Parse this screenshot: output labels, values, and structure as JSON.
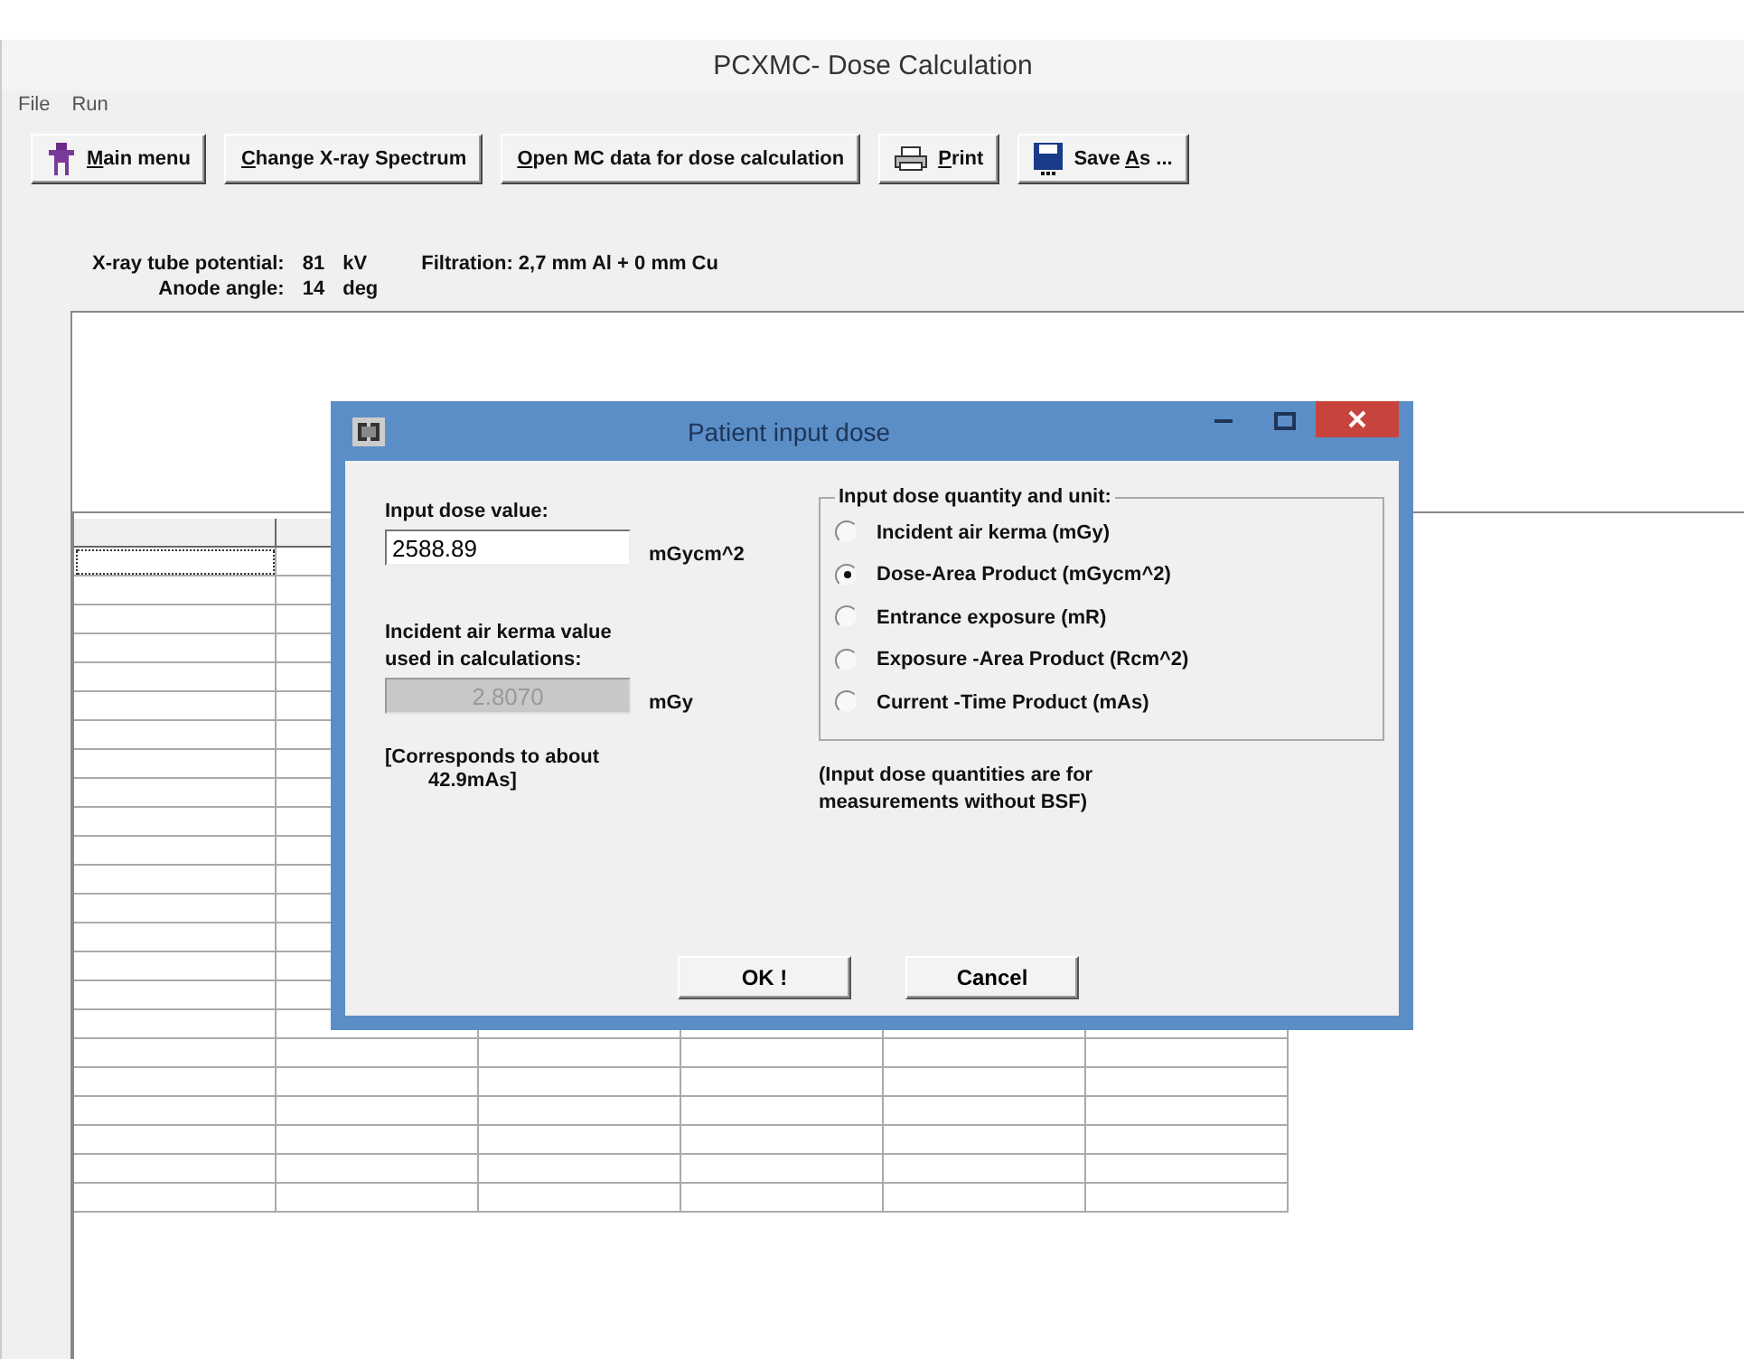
{
  "window": {
    "title": "PCXMC- Dose Calculation"
  },
  "menu": [
    "File",
    "Run"
  ],
  "toolbar": [
    {
      "kind": "person",
      "mnemonic": "M",
      "label_after": "ain menu"
    },
    {
      "kind": "none",
      "mnemonic": "C",
      "label_after": "hange X-ray Spectrum"
    },
    {
      "kind": "none",
      "mnemonic": "O",
      "label_after": "pen MC data for dose calculation"
    },
    {
      "kind": "printer",
      "mnemonic": "P",
      "label_after": "rint"
    },
    {
      "kind": "disk",
      "label_before": "Save ",
      "mnemonic": "A",
      "label_after": "s ..."
    }
  ],
  "info": {
    "tube_potential_label": "X-ray tube potential:",
    "tube_potential": "81",
    "tube_potential_unit": "kV",
    "filtration": "Filtration: 2,7 mm Al + 0 mm Cu",
    "anode_angle_label": "Anode angle:",
    "anode_angle": "14",
    "anode_angle_unit": "deg"
  },
  "dialog": {
    "title": "Patient input dose",
    "input_label": "Input dose value:",
    "input_value": "2588.89",
    "input_unit": "mGycm^2",
    "kerma_label": "Incident air kerma value used in calculations:",
    "kerma_value": "2.8070",
    "kerma_unit": "mGy",
    "note_left": "[Corresponds to about",
    "note_left_2": "42.9mAs]",
    "group_title": "Input dose quantity and unit:",
    "options": [
      {
        "label": "Incident air kerma (mGy)",
        "selected": false
      },
      {
        "label": "Dose-Area Product (mGycm^2)",
        "selected": true
      },
      {
        "label": "Entrance exposure (mR)",
        "selected": false
      },
      {
        "label": "Exposure -Area Product (Rcm^2)",
        "selected": false
      },
      {
        "label": "Current -Time Product (mAs)",
        "selected": false
      }
    ],
    "note_right": "(Input dose quantities are for measurements without BSF)",
    "buttons": [
      "OK !",
      "Cancel"
    ]
  }
}
